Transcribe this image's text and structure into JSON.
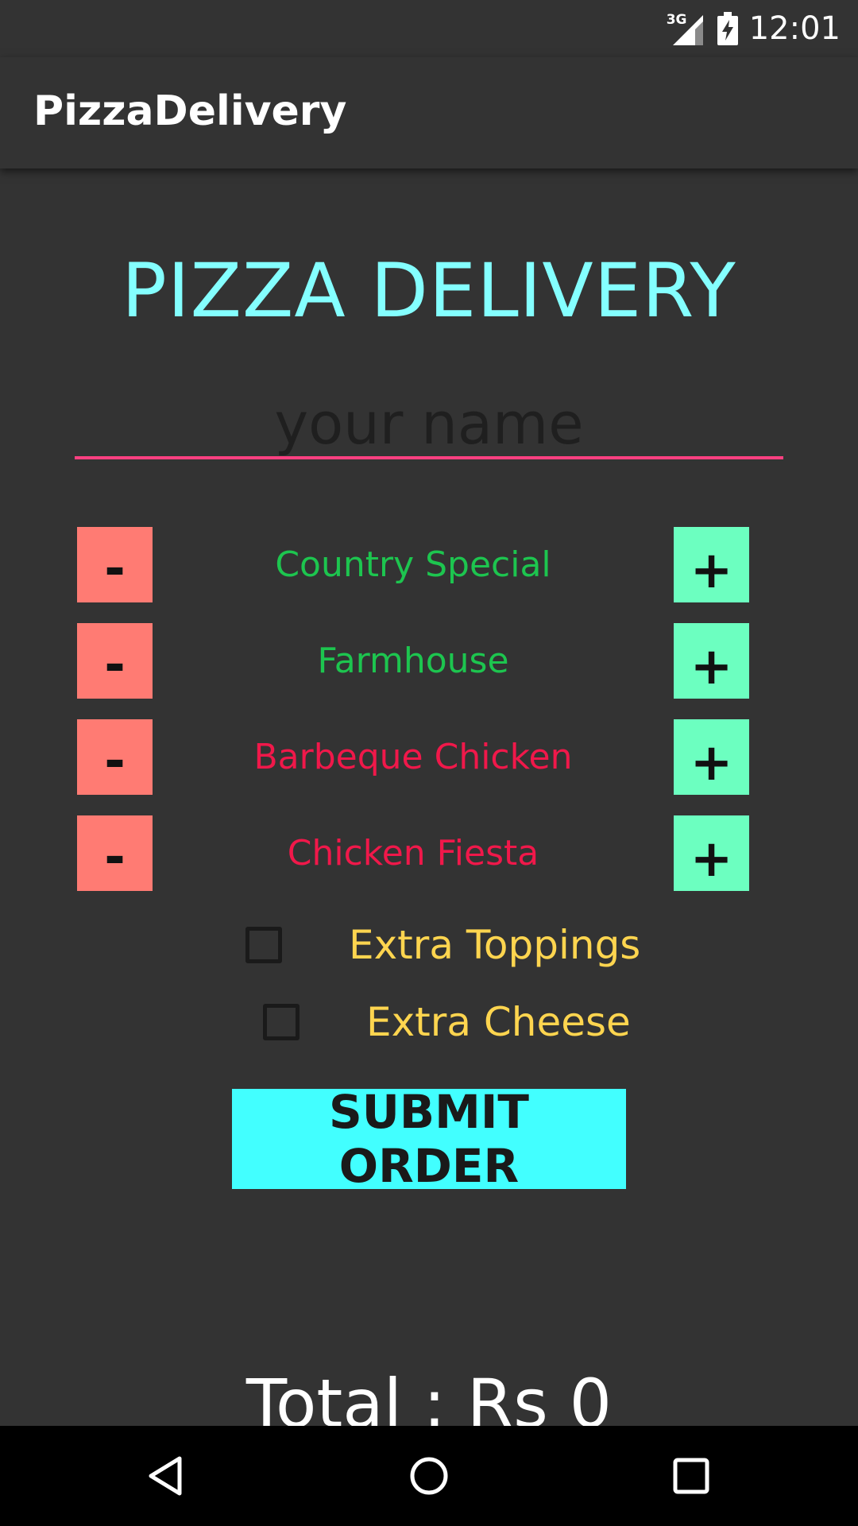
{
  "status_bar": {
    "network_type": "3G",
    "time": "12:01",
    "icons": [
      "signal-icon",
      "battery-charging-icon"
    ]
  },
  "app_bar": {
    "title": "PizzaDelivery"
  },
  "main": {
    "heading": "PIZZA DELIVERY",
    "name_input": {
      "placeholder": "your name",
      "value": ""
    },
    "pizzas": [
      {
        "name": "Country Special",
        "color": "#1DC54F",
        "minus_label": "-",
        "plus_label": "+"
      },
      {
        "name": "Farmhouse",
        "color": "#1DC54F",
        "minus_label": "-",
        "plus_label": "+"
      },
      {
        "name": "Barbeque Chicken",
        "color": "#F0184A",
        "minus_label": "-",
        "plus_label": "+"
      },
      {
        "name": "Chicken Fiesta",
        "color": "#F0184A",
        "minus_label": "-",
        "plus_label": "+"
      }
    ],
    "extras": [
      {
        "label": "Extra Toppings",
        "checked": false
      },
      {
        "label": "Extra Cheese",
        "checked": false
      }
    ],
    "submit_label": "SUBMIT ORDER",
    "total_text": "Total : Rs 0"
  },
  "nav_bar": {
    "icons": [
      "back-icon",
      "home-icon",
      "recents-icon"
    ]
  },
  "colors": {
    "background": "#333333",
    "heading": "#84FFFF",
    "accent_underline": "#FF4081",
    "minus_button": "#FF7B73",
    "plus_button": "#6CFFC0",
    "extra_label": "#FFD54F",
    "submit_button": "#42FFFF"
  }
}
